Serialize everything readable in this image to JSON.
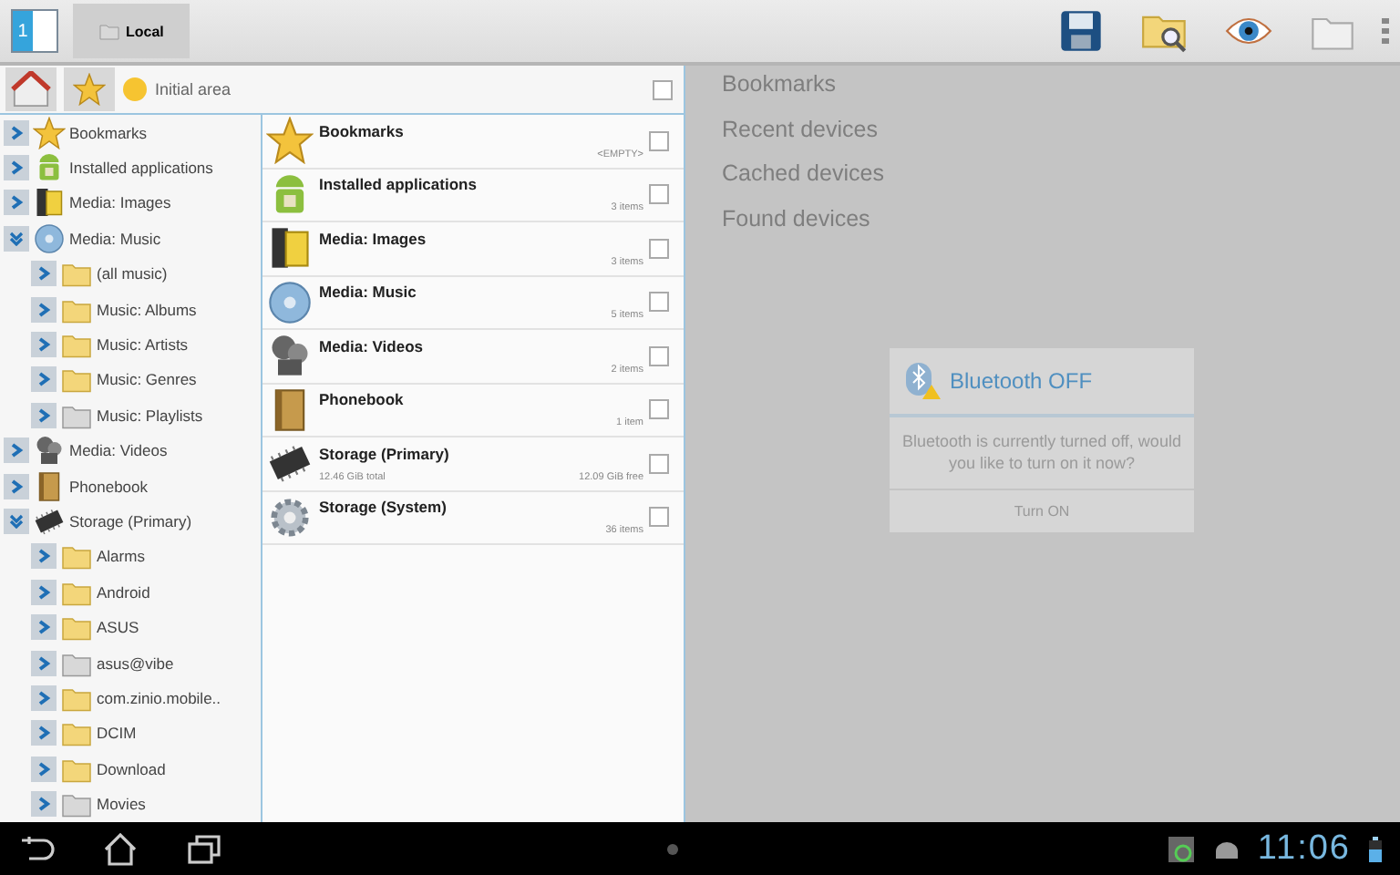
{
  "action_bar": {
    "pane_count": "1",
    "tabs": [
      {
        "label": "Local",
        "selected": true
      }
    ]
  },
  "location": {
    "label": "Initial area",
    "checked": false
  },
  "tree": [
    {
      "label": "Bookmarks",
      "kind": "star",
      "expanded": false
    },
    {
      "label": "Installed applications",
      "kind": "android",
      "expanded": false
    },
    {
      "label": "Media: Images",
      "kind": "film",
      "expanded": false
    },
    {
      "label": "Media: Music",
      "kind": "disc",
      "expanded": true,
      "children": [
        {
          "label": "(all music)",
          "kind": "folder",
          "expanded": false
        },
        {
          "label": "Music: Albums",
          "kind": "folder",
          "expanded": false
        },
        {
          "label": "Music: Artists",
          "kind": "folder",
          "expanded": false
        },
        {
          "label": "Music: Genres",
          "kind": "folder",
          "expanded": false
        },
        {
          "label": "Music: Playlists",
          "kind": "plain-folder",
          "expanded": false
        }
      ]
    },
    {
      "label": "Media: Videos",
      "kind": "reel",
      "expanded": false
    },
    {
      "label": "Phonebook",
      "kind": "book",
      "expanded": false
    },
    {
      "label": "Storage (Primary)",
      "kind": "chip",
      "expanded": true,
      "children": [
        {
          "label": "Alarms",
          "kind": "folder",
          "expanded": false
        },
        {
          "label": "Android",
          "kind": "folder",
          "expanded": false
        },
        {
          "label": "ASUS",
          "kind": "folder",
          "expanded": false
        },
        {
          "label": "asus@vibe",
          "kind": "plain-folder",
          "expanded": false
        },
        {
          "label": "com.zinio.mobile..",
          "kind": "folder",
          "expanded": false
        },
        {
          "label": "DCIM",
          "kind": "folder",
          "expanded": false
        },
        {
          "label": "Download",
          "kind": "folder",
          "expanded": false
        },
        {
          "label": "Movies",
          "kind": "plain-folder",
          "expanded": false
        }
      ]
    }
  ],
  "items": [
    {
      "name": "Bookmarks",
      "kind": "star",
      "info": "<EMPTY>",
      "checked": false
    },
    {
      "name": "Installed applications",
      "kind": "android",
      "info": "3 items",
      "checked": false
    },
    {
      "name": "Media: Images",
      "kind": "film",
      "info": "3 items",
      "checked": false
    },
    {
      "name": "Media: Music",
      "kind": "disc",
      "info": "5 items",
      "checked": false
    },
    {
      "name": "Media: Videos",
      "kind": "reel",
      "info": "2 items",
      "checked": false
    },
    {
      "name": "Phonebook",
      "kind": "book",
      "info": "1 item",
      "checked": false
    },
    {
      "name": "Storage (Primary)",
      "kind": "chip",
      "detail": "12.46 GiB total",
      "info": "12.09 GiB free",
      "checked": false
    },
    {
      "name": "Storage (System)",
      "kind": "gear",
      "info": "36 items",
      "checked": false
    }
  ],
  "remote_sections": [
    "Bookmarks",
    "Recent devices",
    "Cached devices",
    "Found devices"
  ],
  "dialog": {
    "title": "Bluetooth OFF",
    "message": "Bluetooth is currently turned off, would you like to turn on it now?",
    "button": "Turn ON"
  },
  "status_bar": {
    "time": "11:06"
  }
}
